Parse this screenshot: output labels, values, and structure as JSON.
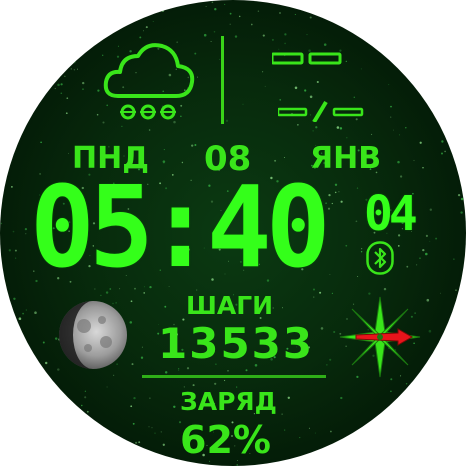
{
  "weather": {
    "icon": "snow-cloud-icon",
    "temperature": "--",
    "minmax": "--/--"
  },
  "date": {
    "weekday": "ПНД",
    "day": "08",
    "month": "ЯНВ"
  },
  "time": {
    "hm": "05:40",
    "seconds": "04"
  },
  "status": {
    "bluetooth_icon": "bluetooth-icon"
  },
  "moon": {
    "icon": "moon-phase-icon"
  },
  "steps": {
    "label": "ШАГИ",
    "value": "13533"
  },
  "battery": {
    "label": "ЗАРЯД",
    "value": "62%"
  },
  "compass": {
    "icon": "compass-icon"
  },
  "colors": {
    "accent": "#39e51a",
    "background": "#062a0c",
    "needle": "#e8141b"
  }
}
